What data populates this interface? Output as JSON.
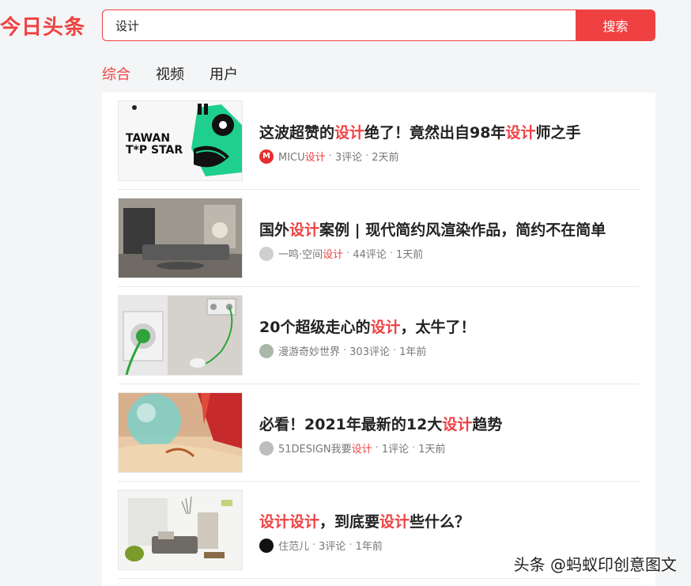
{
  "header": {
    "logo": "今日头条",
    "search_value": "设计",
    "search_button": "搜索"
  },
  "tabs": [
    {
      "label": "综合",
      "active": true
    },
    {
      "label": "视频",
      "active": false
    },
    {
      "label": "用户",
      "active": false
    }
  ],
  "results": [
    {
      "title": [
        {
          "t": "这波超赞的"
        },
        {
          "t": "设计",
          "hl": true
        },
        {
          "t": "绝了！竟然出自98年"
        },
        {
          "t": "设计",
          "hl": true
        },
        {
          "t": "师之手"
        }
      ],
      "source": [
        {
          "t": "MICU"
        },
        {
          "t": "设计",
          "hl": true
        }
      ],
      "comments": "3评论",
      "time": "2天前",
      "avatar_color": "#e62e2e",
      "thumb_text": [
        "TAWAN",
        "T*P STAR"
      ]
    },
    {
      "title": [
        {
          "t": "国外"
        },
        {
          "t": "设计",
          "hl": true
        },
        {
          "t": "案例 | 现代简约风渲染作品，简约不在简单"
        }
      ],
      "source": [
        {
          "t": "一鸣·空间"
        },
        {
          "t": "设计",
          "hl": true
        }
      ],
      "comments": "44评论",
      "time": "1天前",
      "avatar_color": "#cfcfcf"
    },
    {
      "title": [
        {
          "t": "20个超级走心的"
        },
        {
          "t": "设计",
          "hl": true
        },
        {
          "t": "，太牛了！"
        }
      ],
      "source": [
        {
          "t": "漫游奇妙世界"
        }
      ],
      "comments": "303评论",
      "time": "1年前",
      "avatar_color": "#a9b8a9"
    },
    {
      "title": [
        {
          "t": "必看！2021年最新的12大"
        },
        {
          "t": "设计",
          "hl": true
        },
        {
          "t": "趋势"
        }
      ],
      "source": [
        {
          "t": "51DESIGN我要"
        },
        {
          "t": "设计",
          "hl": true
        }
      ],
      "comments": "1评论",
      "time": "1天前",
      "avatar_color": "#bdbdbd"
    },
    {
      "title": [
        {
          "t": "设计设计",
          "hl": true
        },
        {
          "t": "，到底要"
        },
        {
          "t": "设计",
          "hl": true
        },
        {
          "t": "些什么？"
        }
      ],
      "source": [
        {
          "t": "住范儿"
        }
      ],
      "comments": "3评论",
      "time": "1年前",
      "avatar_color": "#111111"
    }
  ],
  "watermark": "头条 @蚂蚁印创意图文",
  "colors": {
    "accent": "#f04142"
  }
}
